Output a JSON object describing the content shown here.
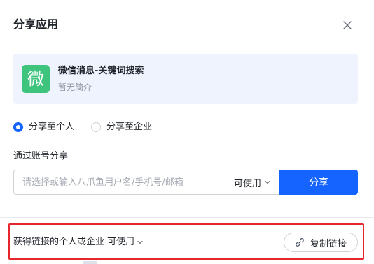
{
  "dialog": {
    "title": "分享应用"
  },
  "app": {
    "icon_char": "微",
    "icon_color": "#3ec47d",
    "name": "微信消息-关键词搜索",
    "description": "暂无简介"
  },
  "share_target": {
    "options": [
      {
        "label": "分享至个人",
        "selected": true
      },
      {
        "label": "分享至企业",
        "selected": false
      }
    ]
  },
  "account_share": {
    "label": "通过账号分享",
    "input_placeholder": "请选择或输入八爪鱼用户名/手机号/邮箱",
    "input_value": "",
    "permission": "可使用",
    "share_button": "分享"
  },
  "link_share": {
    "text": "获得链接的个人或企业",
    "permission": "可使用",
    "copy_button": "复制链接"
  },
  "colors": {
    "primary": "#1664ff",
    "highlight_border": "#e5262b",
    "card_background": "#eff3fd"
  },
  "icons": {
    "close": "close-icon",
    "chevron": "chevron-down-icon",
    "link": "link-icon"
  }
}
